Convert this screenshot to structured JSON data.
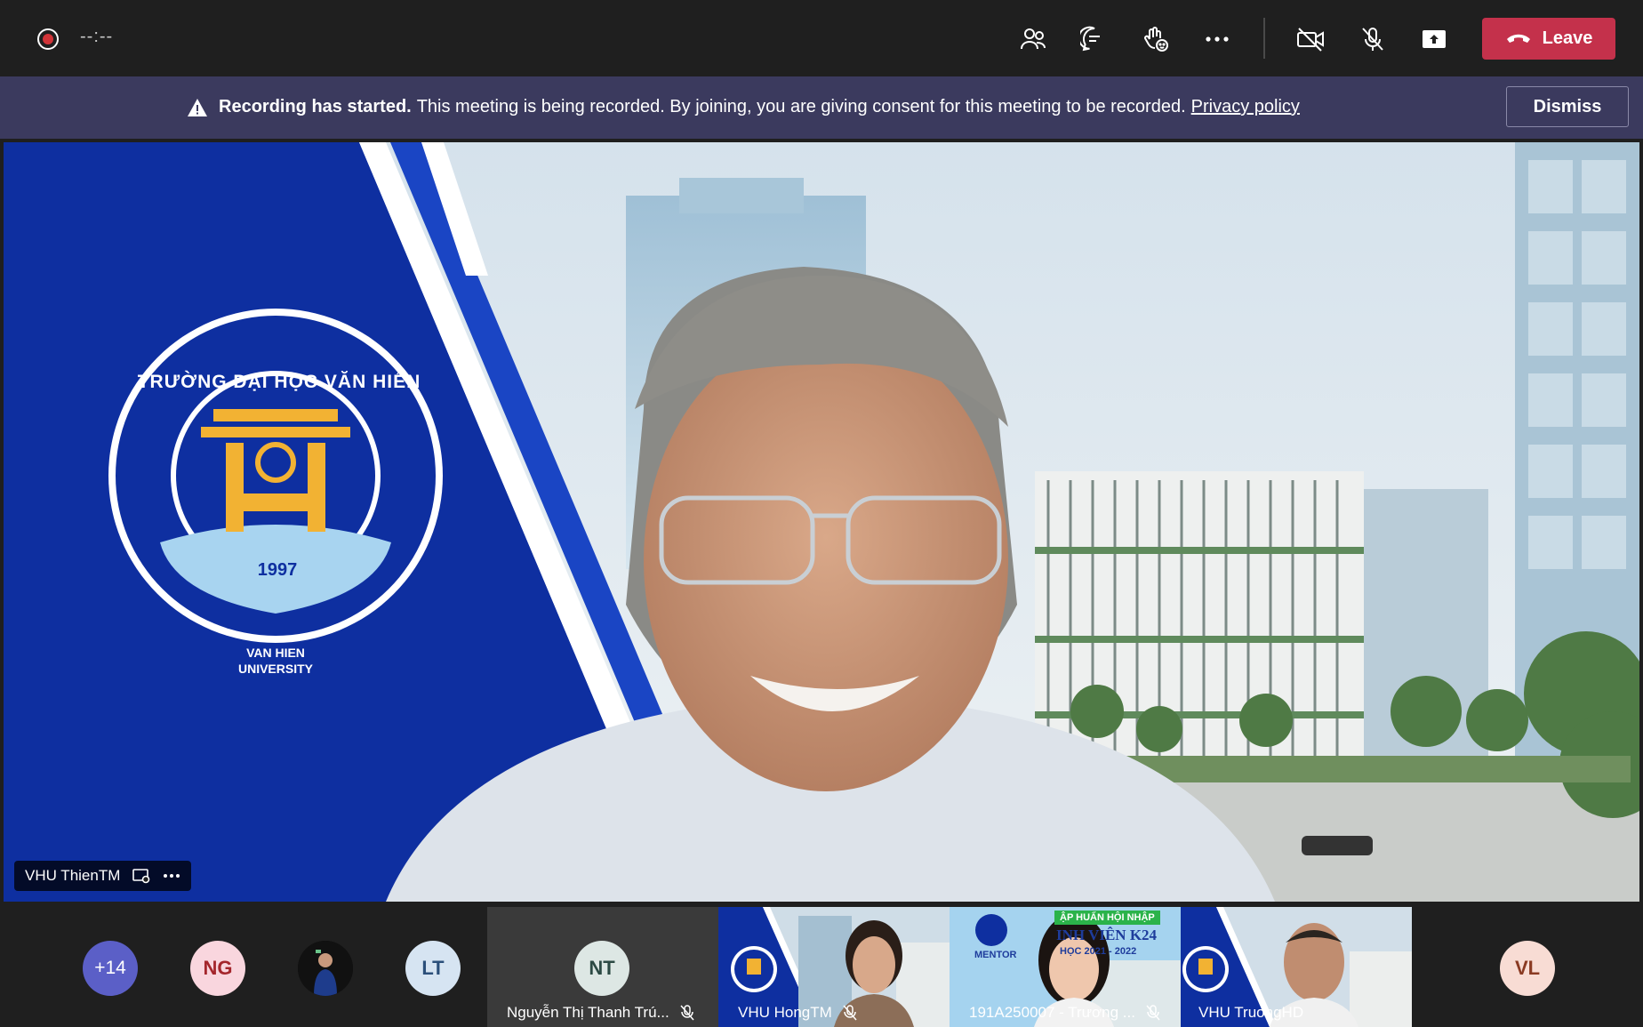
{
  "toolbar": {
    "timer": "--:--",
    "leave_label": "Leave",
    "leave_color": "#c4314b",
    "icons": [
      "people-icon",
      "chat-icon",
      "raise-hand-icon",
      "more-icon",
      "camera-off-icon",
      "mic-off-icon",
      "share-screen-icon",
      "phone-hangup-icon"
    ]
  },
  "banner": {
    "title": "Recording has started.",
    "message": "This meeting is being recorded. By joining, you are giving consent for this meeting to be recorded.",
    "link": "Privacy policy",
    "dismiss_label": "Dismiss",
    "background": "#3b3a5e"
  },
  "main_video": {
    "participant_name": "VHU ThienTM",
    "logo": {
      "ring_text": "TRƯỜNG ĐẠI HỌC VĂN HIẾN",
      "year": "1997",
      "sub_line1": "VAN HIEN",
      "sub_line2": "UNIVERSITY"
    }
  },
  "participants": {
    "overflow": "+14",
    "avatars": [
      {
        "initials": "NG",
        "bg": "#f9d6de",
        "fg": "#a4262c"
      },
      {
        "initials": "LT",
        "bg": "#d6e4f2",
        "fg": "#2b4f7a"
      },
      {
        "initials": "NT",
        "bg": "#dde7e4",
        "fg": "#2c4a44"
      },
      {
        "initials": "VL",
        "bg": "#f8dcd4",
        "fg": "#8a3a22"
      }
    ],
    "tiles": [
      {
        "name": "Nguyễn Thị Thanh Trú..."
      },
      {
        "name": "VHU HongTM"
      },
      {
        "name": "191A250007 - Trương ..."
      },
      {
        "name": "VHU TruongHD"
      }
    ],
    "tile_banner_line1": "ẬP HUẤN HỘI NHẬP",
    "tile_banner_line2": "INH VIÊN K24",
    "tile_banner_line3": "HỌC 2021 - 2022",
    "tile_mentor": "MENTOR"
  }
}
